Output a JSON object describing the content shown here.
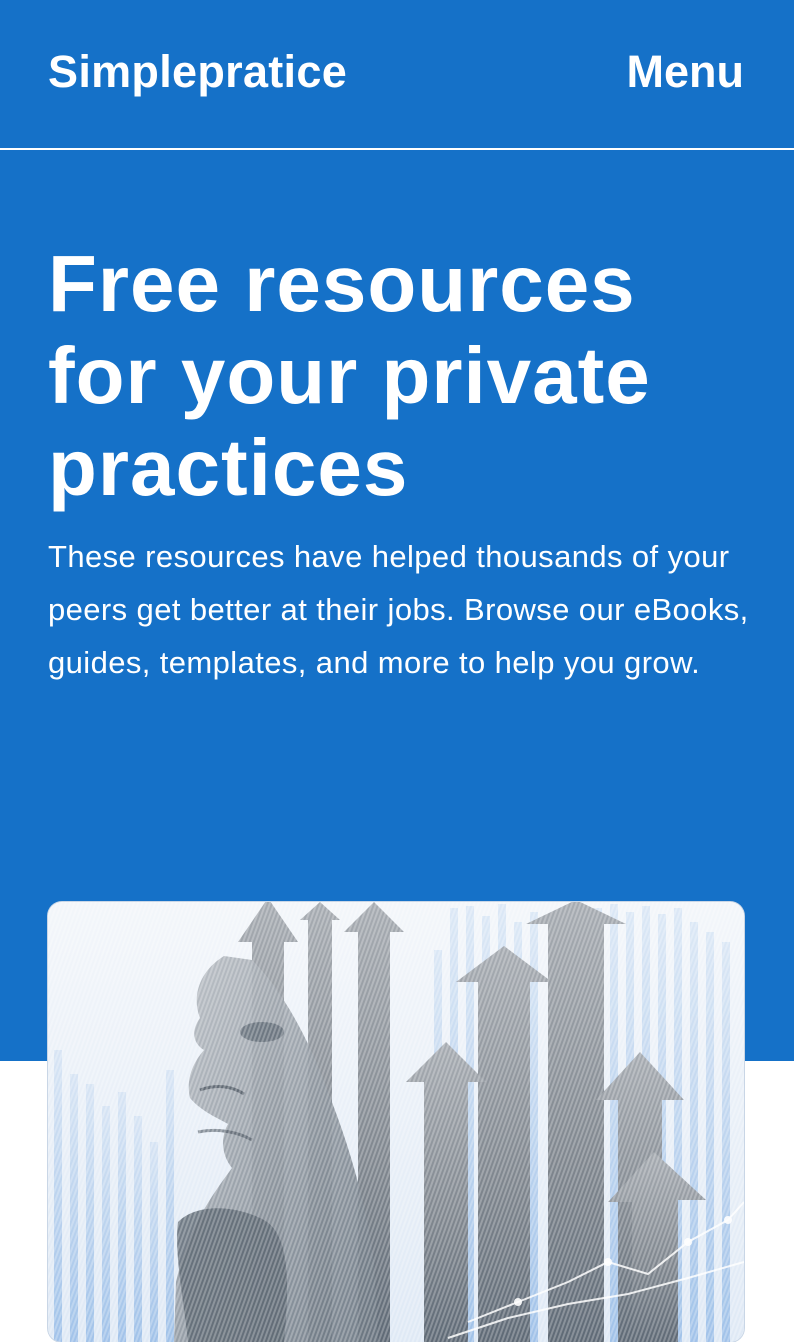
{
  "header": {
    "brand": "Simplepratice",
    "menu_label": "Menu"
  },
  "hero": {
    "title": "Free resources for your private practices",
    "subtitle": "These resources have helped thousands of your peers get better at their jobs. Browse our eBooks, guides, templates, and more to help you grow."
  },
  "colors": {
    "brand_blue": "#1571c8",
    "text_on_brand": "#ffffff"
  }
}
